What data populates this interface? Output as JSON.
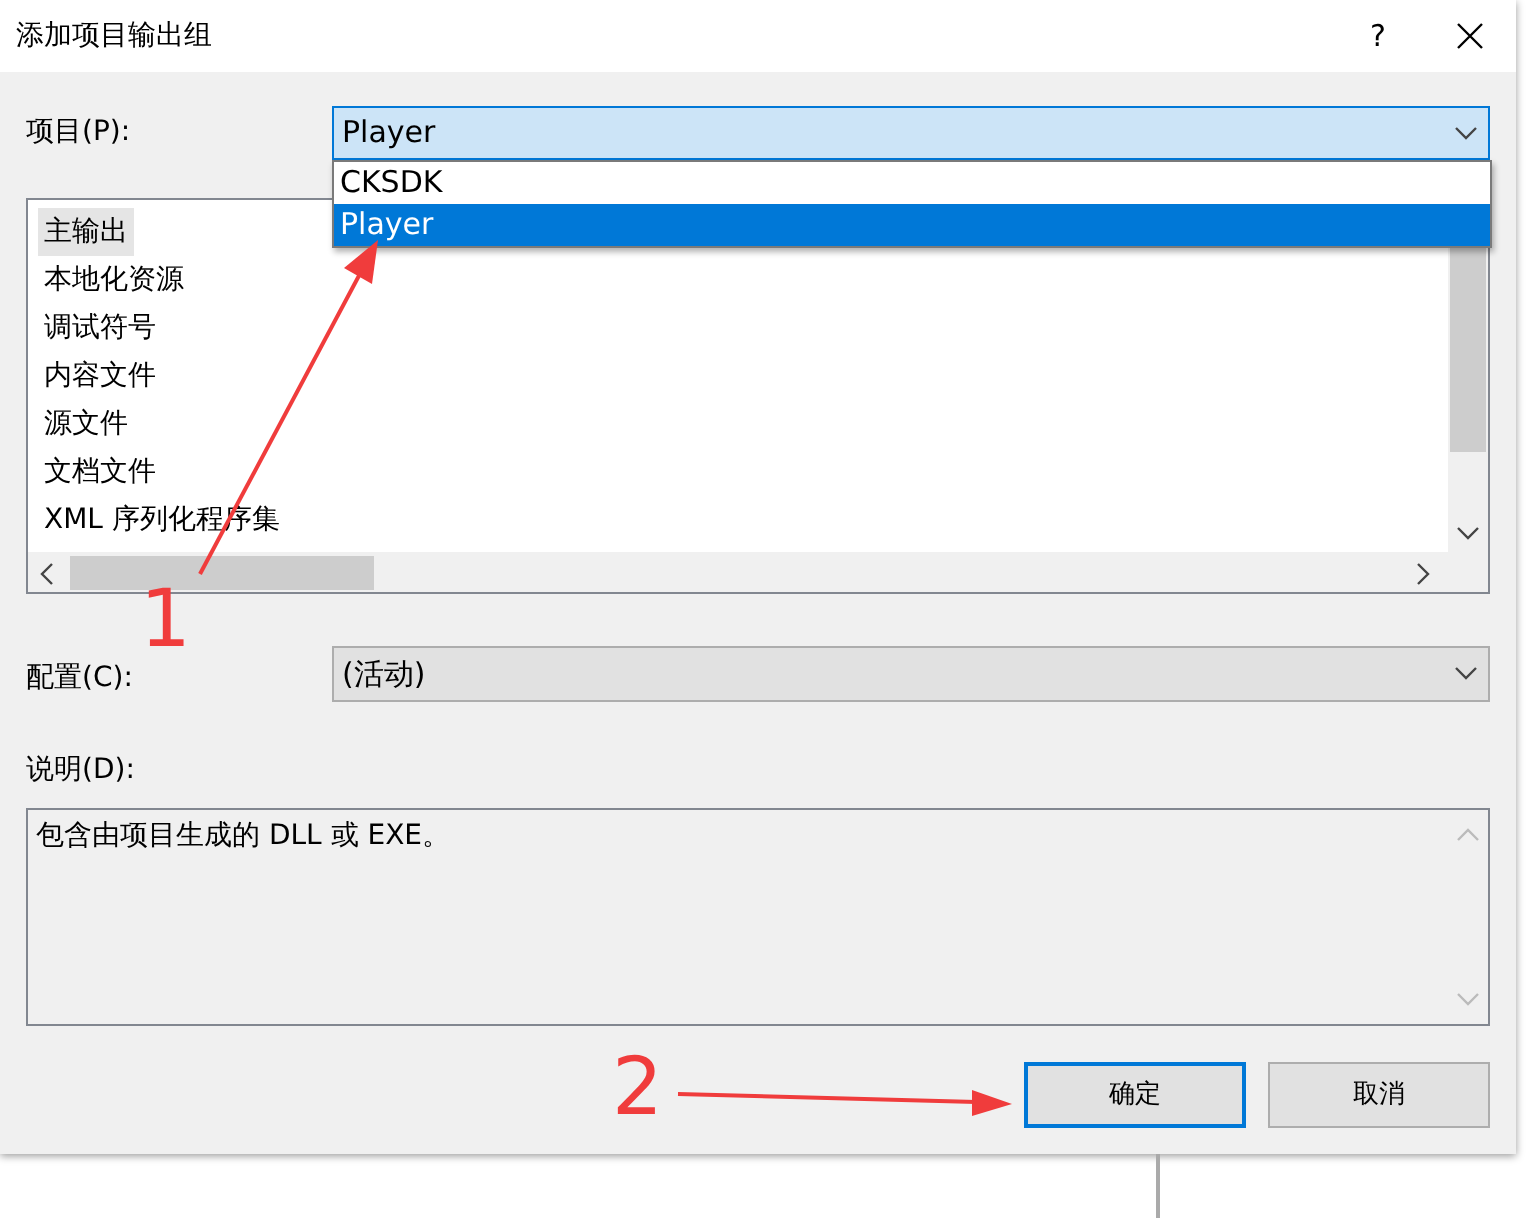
{
  "window": {
    "title": "添加项目输出组",
    "help": "?"
  },
  "project": {
    "label": "项目(P):",
    "value": "Player",
    "open": true,
    "options": [
      {
        "label": "CKSDK",
        "selected": false
      },
      {
        "label": "Player",
        "selected": true
      }
    ]
  },
  "outputs": [
    {
      "label": "主输出",
      "selected": true
    },
    {
      "label": "本地化资源",
      "selected": false
    },
    {
      "label": "调试符号",
      "selected": false
    },
    {
      "label": "内容文件",
      "selected": false
    },
    {
      "label": "源文件",
      "selected": false
    },
    {
      "label": "文档文件",
      "selected": false
    },
    {
      "label": "XML 序列化程序集",
      "selected": false
    }
  ],
  "configuration": {
    "label": "配置(C):",
    "value": "(活动)"
  },
  "description": {
    "label": "说明(D):",
    "text": "包含由项目生成的 DLL 或 EXE。"
  },
  "buttons": [
    {
      "label": "确定",
      "default": true
    },
    {
      "label": "取消",
      "default": false
    }
  ],
  "annotations": [
    {
      "label": "1"
    },
    {
      "label": "2"
    }
  ]
}
